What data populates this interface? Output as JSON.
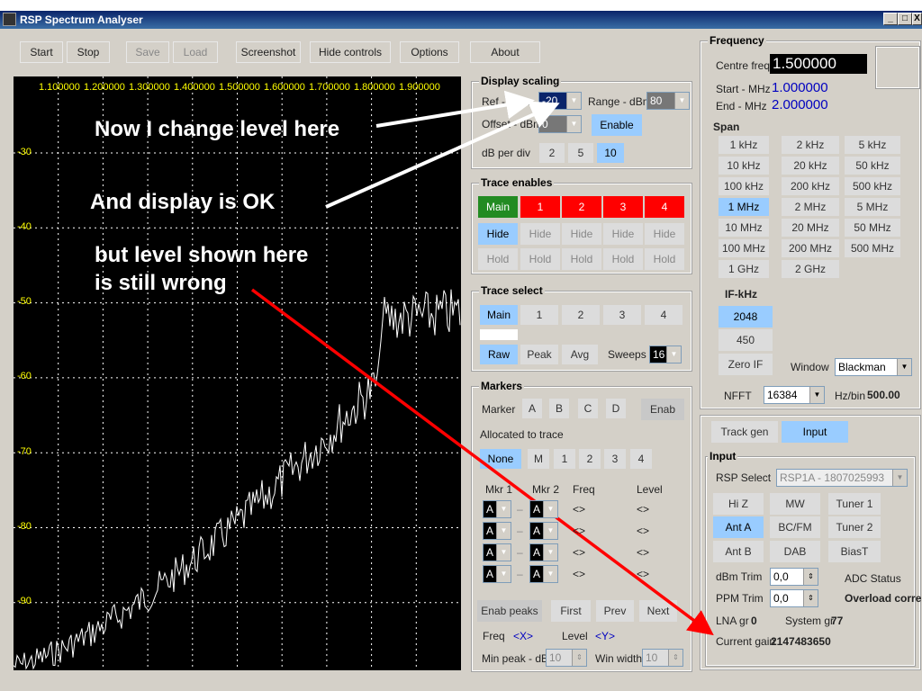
{
  "window": {
    "title": "RSP Spectrum Analyser",
    "min": "_",
    "max": "□",
    "close": "X"
  },
  "toolbar": {
    "start": "Start",
    "stop": "Stop",
    "save": "Save",
    "load": "Load",
    "screenshot": "Screenshot",
    "hide_controls": "Hide controls",
    "options": "Options",
    "about": "About"
  },
  "plot": {
    "x_ticks": [
      "1.100000",
      "1.200000",
      "1.300000",
      "1.400000",
      "1.500000",
      "1.600000",
      "1.700000",
      "1.800000",
      "1.900000"
    ],
    "y_ticks": [
      "-30",
      "-40",
      "-50",
      "-60",
      "-70",
      "-80",
      "-90"
    ],
    "trace_color": "#ffffff",
    "grid_color": "#ffffff",
    "tick_color": "#ffff00"
  },
  "annotations": {
    "a1": "Now I change level here",
    "a2": "And display is OK",
    "a3": "but level shown here",
    "a4": "is still wrong"
  },
  "display_scaling": {
    "title": "Display scaling",
    "ref_label": "Ref - dBm",
    "ref_value": "-20",
    "range_label": "Range - dBm",
    "range_value": "80",
    "offset_label": "Offset - dBm",
    "offset_value": "0",
    "enable": "Enable",
    "dbdiv_label": "dB per div",
    "dbdiv": [
      "2",
      "5",
      "10"
    ]
  },
  "trace_enables": {
    "title": "Trace enables",
    "traces": [
      "Main",
      "1",
      "2",
      "3",
      "4"
    ],
    "hide": "Hide",
    "hold": "Hold"
  },
  "trace_select": {
    "title": "Trace select",
    "traces": [
      "Main",
      "1",
      "2",
      "3",
      "4"
    ],
    "raw": "Raw",
    "peak": "Peak",
    "avg": "Avg",
    "sweeps_label": "Sweeps",
    "sweeps_value": "16"
  },
  "markers": {
    "title": "Markers",
    "marker_label": "Marker",
    "markers": [
      "A",
      "B",
      "C",
      "D"
    ],
    "enab": "Enab",
    "alloc_label": "Allocated to trace",
    "alloc": [
      "None",
      "M",
      "1",
      "2",
      "3",
      "4"
    ],
    "mkr1": "Mkr 1",
    "mkr2": "Mkr 2",
    "freq": "Freq",
    "level": "Level",
    "sel_val": "A",
    "dash": "–",
    "val": "<>",
    "enab_peaks": "Enab peaks",
    "first": "First",
    "prev": "Prev",
    "next": "Next",
    "freq_label": "Freq",
    "freq_val": "<X>",
    "level_label": "Level",
    "level_val": "<Y>",
    "minpeak_label": "Min peak - dB",
    "minpeak_val": "10",
    "winwidth_label": "Win width",
    "winwidth_val": "10"
  },
  "frequency": {
    "title": "Frequency",
    "centre_label": "Centre freq",
    "centre_value": "1.500000",
    "start_label": "Start - MHz",
    "start_value": "1.000000",
    "end_label": "End - MHz",
    "end_value": "2.000000",
    "span_label": "Span",
    "spans": [
      "1 kHz",
      "2 kHz",
      "5 kHz",
      "10 kHz",
      "20 kHz",
      "50 kHz",
      "100 kHz",
      "200 kHz",
      "500 kHz",
      "1 MHz",
      "2 MHz",
      "5 MHz",
      "10 MHz",
      "20 MHz",
      "50 MHz",
      "100 MHz",
      "200 MHz",
      "500 MHz",
      "1 GHz",
      "2 GHz"
    ],
    "if_label": "IF-kHz",
    "if": [
      "2048",
      "450",
      "Zero IF"
    ],
    "window_label": "Window",
    "window_value": "Blackman",
    "nfft_label": "NFFT",
    "nfft_value": "16384",
    "hzbin_label": "Hz/bin",
    "hzbin_value": "500.00"
  },
  "tabs": {
    "track_gen": "Track gen",
    "input": "Input"
  },
  "input": {
    "title": "Input",
    "rsp_label": "RSP Select",
    "rsp_value": "RSP1A - 1807025993",
    "hiz": "Hi Z",
    "mw": "MW",
    "tuner1": "Tuner 1",
    "anta": "Ant A",
    "bcfm": "BC/FM",
    "tuner2": "Tuner 2",
    "antb": "Ant B",
    "dab": "DAB",
    "biast": "BiasT",
    "dbm_trim_label": "dBm Trim",
    "dbm_trim": "0,0",
    "ppm_trim_label": "PPM Trim",
    "ppm_trim": "0,0",
    "adc_status": "ADC Status",
    "overload": "Overload corre",
    "lna_label": "LNA gr",
    "lna_value": "0",
    "system_label": "System gr",
    "system_value": "77",
    "gain_label": "Current gain",
    "gain_value": "2147483650"
  }
}
